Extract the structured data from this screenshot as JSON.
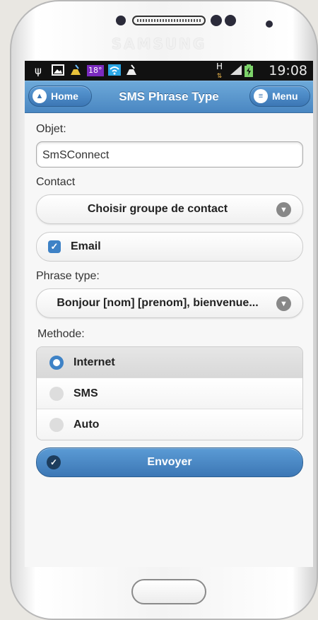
{
  "device": {
    "brand": "SAMSUNG"
  },
  "status_bar": {
    "time": "19:08",
    "temperature_badge": "18°",
    "network_label": "H",
    "icons": [
      "usb-icon",
      "image-icon",
      "cleaner-icon",
      "temperature-icon",
      "wifi-icon",
      "cleaner-icon",
      "network-h-icon",
      "signal-icon",
      "battery-icon"
    ]
  },
  "header": {
    "home_label": "Home",
    "title": "SMS Phrase Type",
    "menu_label": "Menu"
  },
  "form": {
    "objet_label": "Objet:",
    "objet_value": "SmSConnect",
    "contact_label": "Contact",
    "contact_select": "Choisir groupe de contact",
    "email_label": "Email",
    "email_checked": true,
    "phrase_label": "Phrase type:",
    "phrase_select": "Bonjour [nom] [prenom], bienvenue...",
    "methode_label": "Methode:",
    "methods": [
      {
        "label": "Internet",
        "selected": true
      },
      {
        "label": "SMS",
        "selected": false
      },
      {
        "label": "Auto",
        "selected": false
      }
    ],
    "submit_label": "Envoyer"
  },
  "colors": {
    "header_blue": "#4a87c2",
    "accent": "#3e82c6",
    "statusbar": "#111111"
  }
}
